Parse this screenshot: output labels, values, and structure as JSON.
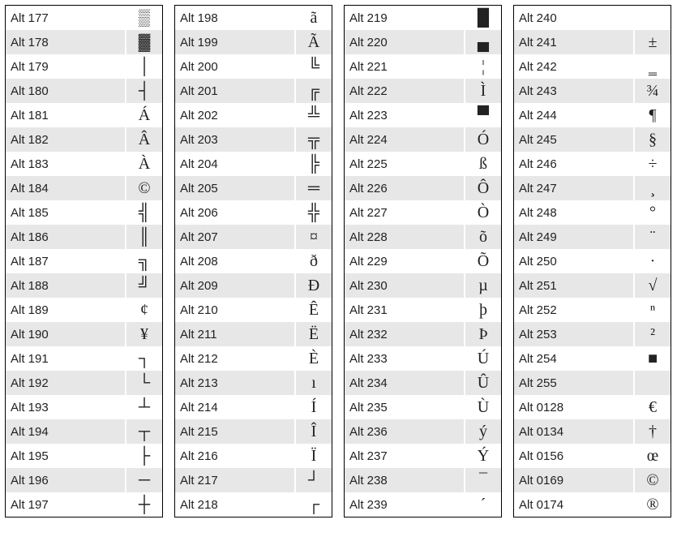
{
  "columns": [
    {
      "rows": [
        {
          "code": "Alt 177",
          "symbol": "▒"
        },
        {
          "code": "Alt 178",
          "symbol": "▓"
        },
        {
          "code": "Alt 179",
          "symbol": "│"
        },
        {
          "code": "Alt 180",
          "symbol": "┤"
        },
        {
          "code": "Alt 181",
          "symbol": "Á"
        },
        {
          "code": "Alt 182",
          "symbol": "Â"
        },
        {
          "code": "Alt 183",
          "symbol": "À"
        },
        {
          "code": "Alt 184",
          "symbol": "©"
        },
        {
          "code": "Alt 185",
          "symbol": "╣"
        },
        {
          "code": "Alt 186",
          "symbol": "║"
        },
        {
          "code": "Alt 187",
          "symbol": "╗"
        },
        {
          "code": "Alt 188",
          "symbol": "╝"
        },
        {
          "code": "Alt 189",
          "symbol": "¢"
        },
        {
          "code": "Alt 190",
          "symbol": "¥"
        },
        {
          "code": "Alt 191",
          "symbol": "┐"
        },
        {
          "code": "Alt 192",
          "symbol": "└"
        },
        {
          "code": "Alt 193",
          "symbol": "┴"
        },
        {
          "code": "Alt 194",
          "symbol": "┬"
        },
        {
          "code": "Alt 195",
          "symbol": "├"
        },
        {
          "code": "Alt 196",
          "symbol": "─"
        },
        {
          "code": "Alt 197",
          "symbol": "┼"
        }
      ]
    },
    {
      "rows": [
        {
          "code": "Alt 198",
          "symbol": "ã"
        },
        {
          "code": "Alt 199",
          "symbol": "Ã"
        },
        {
          "code": "Alt 200",
          "symbol": "╚"
        },
        {
          "code": "Alt 201",
          "symbol": "╔"
        },
        {
          "code": "Alt 202",
          "symbol": "╩"
        },
        {
          "code": "Alt 203",
          "symbol": "╦"
        },
        {
          "code": "Alt 204",
          "symbol": "╠"
        },
        {
          "code": "Alt 205",
          "symbol": "═"
        },
        {
          "code": "Alt 206",
          "symbol": "╬"
        },
        {
          "code": "Alt 207",
          "symbol": "¤"
        },
        {
          "code": "Alt 208",
          "symbol": "ð"
        },
        {
          "code": "Alt 209",
          "symbol": "Ð"
        },
        {
          "code": "Alt 210",
          "symbol": "Ê"
        },
        {
          "code": "Alt 211",
          "symbol": "Ë"
        },
        {
          "code": "Alt 212",
          "symbol": "È"
        },
        {
          "code": "Alt 213",
          "symbol": "ı"
        },
        {
          "code": "Alt 214",
          "symbol": "Í"
        },
        {
          "code": "Alt 215",
          "symbol": "Î"
        },
        {
          "code": "Alt 216",
          "symbol": "Ï"
        },
        {
          "code": "Alt 217",
          "symbol": "┘"
        },
        {
          "code": "Alt 218",
          "symbol": "┌"
        }
      ]
    },
    {
      "rows": [
        {
          "code": "Alt 219",
          "symbol": "█"
        },
        {
          "code": "Alt 220",
          "symbol": "▄"
        },
        {
          "code": "Alt 221",
          "symbol": "¦"
        },
        {
          "code": "Alt 222",
          "symbol": "Ì"
        },
        {
          "code": "Alt 223",
          "symbol": "▀"
        },
        {
          "code": "Alt 224",
          "symbol": "Ó"
        },
        {
          "code": "Alt 225",
          "symbol": "ß"
        },
        {
          "code": "Alt 226",
          "symbol": "Ô"
        },
        {
          "code": "Alt 227",
          "symbol": "Ò"
        },
        {
          "code": "Alt 228",
          "symbol": "õ"
        },
        {
          "code": "Alt 229",
          "symbol": "Õ"
        },
        {
          "code": "Alt 230",
          "symbol": "µ"
        },
        {
          "code": "Alt 231",
          "symbol": "þ"
        },
        {
          "code": "Alt 232",
          "symbol": "Þ"
        },
        {
          "code": "Alt 233",
          "symbol": "Ú"
        },
        {
          "code": "Alt 234",
          "symbol": "Û"
        },
        {
          "code": "Alt 235",
          "symbol": "Ù"
        },
        {
          "code": "Alt 236",
          "symbol": "ý"
        },
        {
          "code": "Alt 237",
          "symbol": "Ý"
        },
        {
          "code": "Alt 238",
          "symbol": "¯"
        },
        {
          "code": "Alt 239",
          "symbol": "´"
        }
      ]
    },
    {
      "rows": [
        {
          "code": "Alt 240",
          "symbol": ""
        },
        {
          "code": "Alt 241",
          "symbol": "±"
        },
        {
          "code": "Alt 242",
          "symbol": "‗"
        },
        {
          "code": "Alt 243",
          "symbol": "¾"
        },
        {
          "code": "Alt 244",
          "symbol": "¶"
        },
        {
          "code": "Alt 245",
          "symbol": "§"
        },
        {
          "code": "Alt 246",
          "symbol": "÷"
        },
        {
          "code": "Alt 247",
          "symbol": "¸"
        },
        {
          "code": "Alt 248",
          "symbol": "°"
        },
        {
          "code": "Alt 249",
          "symbol": "¨"
        },
        {
          "code": "Alt 250",
          "symbol": "·"
        },
        {
          "code": "Alt 251",
          "symbol": "√"
        },
        {
          "code": "Alt 252",
          "symbol": "ⁿ"
        },
        {
          "code": "Alt 253",
          "symbol": "²"
        },
        {
          "code": "Alt 254",
          "symbol": "■"
        },
        {
          "code": "Alt 255",
          "symbol": " "
        },
        {
          "code": "Alt 0128",
          "symbol": "€"
        },
        {
          "code": "Alt 0134",
          "symbol": "†"
        },
        {
          "code": "Alt 0156",
          "symbol": "œ"
        },
        {
          "code": "Alt 0169",
          "symbol": "©"
        },
        {
          "code": "Alt 0174",
          "symbol": "®"
        }
      ]
    }
  ]
}
